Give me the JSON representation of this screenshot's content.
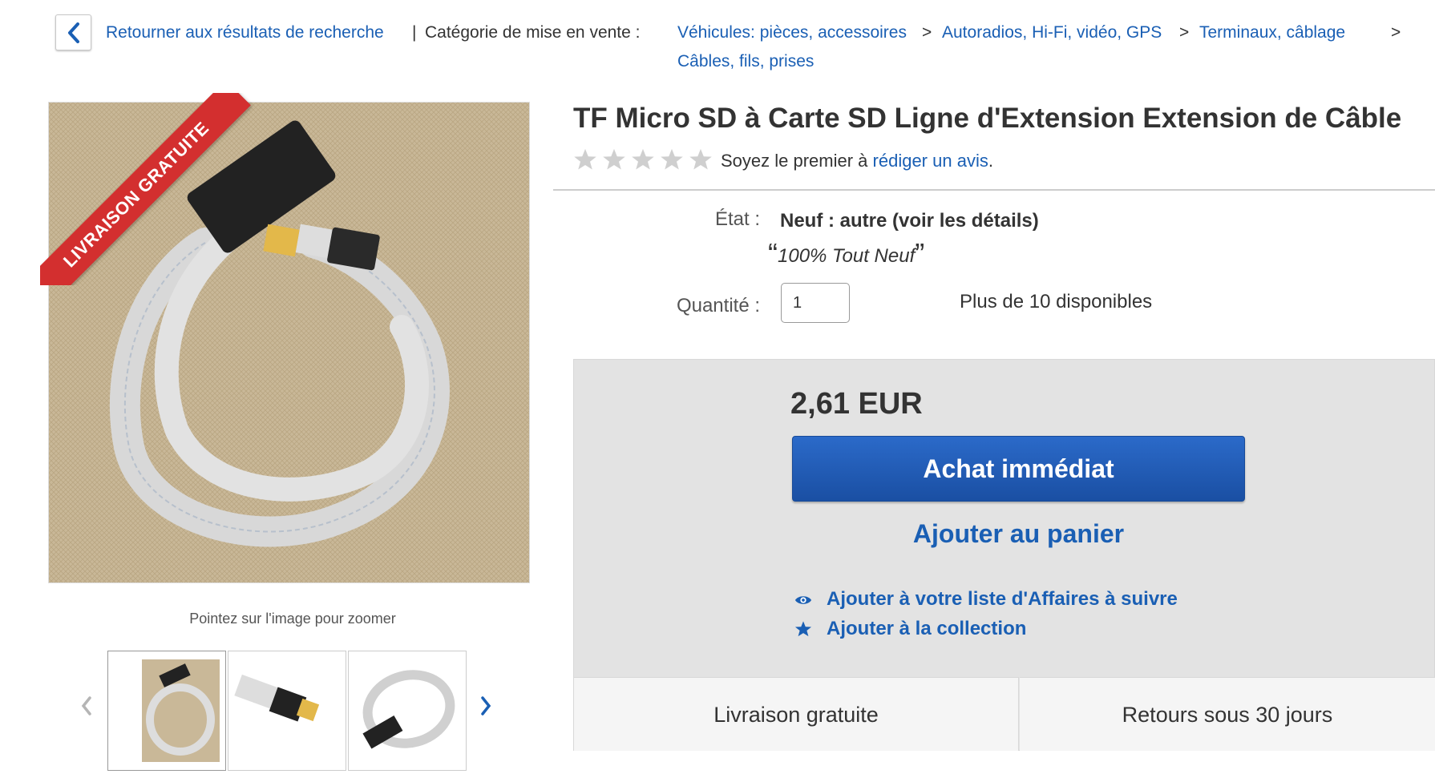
{
  "breadcrumb": {
    "back_results": "Retourner aux résultats de recherche",
    "pipe": "|",
    "category_label": "Catégorie de mise en vente :",
    "crumbs": [
      "Véhicules: pièces, accessoires",
      "Autoradios, Hi-Fi, vidéo, GPS",
      "Terminaux, câblage",
      "Câbles, fils, prises"
    ],
    "separator": ">"
  },
  "gallery": {
    "ribbon": "LIVRAISON GRATUITE",
    "zoom_hint": "Pointez sur l'image pour zoomer",
    "thumbnails": [
      "thumb-1",
      "thumb-2",
      "thumb-3"
    ]
  },
  "product": {
    "title": "TF Micro SD à Carte SD Ligne d'Extension Extension de Câble",
    "review_prefix": "Soyez le premier à ",
    "review_link": "rédiger un avis",
    "review_suffix": ".",
    "rating_stars": 0,
    "condition_label": "État :",
    "condition_value": "Neuf : autre (voir les détails)",
    "condition_quote": "100% Tout Neuf",
    "quantity_label": "Quantité :",
    "quantity_value": "1",
    "availability": "Plus de 10 disponibles"
  },
  "buy": {
    "price": "2,61 EUR",
    "buy_now": "Achat immédiat",
    "add_to_cart": "Ajouter au panier",
    "watch_list": "Ajouter à votre liste d'Affaires à suivre",
    "collection": "Ajouter à la collection",
    "shipping": "Livraison gratuite",
    "returns": "Retours sous 30 jours"
  },
  "colors": {
    "link": "#1a5fb4",
    "buy_button": "#2158b3",
    "ribbon": "#d32f2f",
    "buy_box": "#e3e3e3"
  }
}
